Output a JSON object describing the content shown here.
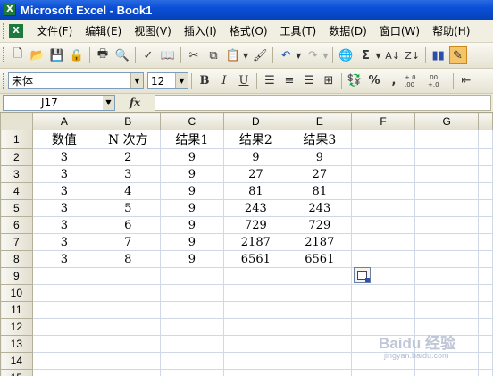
{
  "window": {
    "title": "Microsoft Excel - Book1",
    "app_icon": "X"
  },
  "menu": {
    "items": [
      {
        "label": "文件(F)"
      },
      {
        "label": "编辑(E)"
      },
      {
        "label": "视图(V)"
      },
      {
        "label": "插入(I)"
      },
      {
        "label": "格式(O)"
      },
      {
        "label": "工具(T)"
      },
      {
        "label": "数据(D)"
      },
      {
        "label": "窗口(W)"
      },
      {
        "label": "帮助(H)"
      }
    ]
  },
  "format_toolbar": {
    "font_name": "宋体",
    "font_size": "12",
    "bold": "B",
    "italic": "I",
    "underline": "U",
    "percent": "%",
    "comma": ",",
    "inc_decimal": "+.0 .00",
    "dec_decimal": ".00 +.0"
  },
  "formula_bar": {
    "name_box": "J17",
    "fx": "fx",
    "content": ""
  },
  "columns": [
    "A",
    "B",
    "C",
    "D",
    "E",
    "F",
    "G"
  ],
  "rows": [
    [
      "数值",
      "N 次方",
      "结果1",
      "结果2",
      "结果3",
      "",
      ""
    ],
    [
      "3",
      "2",
      "9",
      "9",
      "9",
      "",
      ""
    ],
    [
      "3",
      "3",
      "9",
      "27",
      "27",
      "",
      ""
    ],
    [
      "3",
      "4",
      "9",
      "81",
      "81",
      "",
      ""
    ],
    [
      "3",
      "5",
      "9",
      "243",
      "243",
      "",
      ""
    ],
    [
      "3",
      "6",
      "9",
      "729",
      "729",
      "",
      ""
    ],
    [
      "3",
      "7",
      "9",
      "2187",
      "2187",
      "",
      ""
    ],
    [
      "3",
      "8",
      "9",
      "6561",
      "6561",
      "",
      ""
    ],
    [
      "",
      "",
      "",
      "",
      "",
      "",
      ""
    ],
    [
      "",
      "",
      "",
      "",
      "",
      "",
      ""
    ],
    [
      "",
      "",
      "",
      "",
      "",
      "",
      ""
    ],
    [
      "",
      "",
      "",
      "",
      "",
      "",
      ""
    ],
    [
      "",
      "",
      "",
      "",
      "",
      "",
      ""
    ],
    [
      "",
      "",
      "",
      "",
      "",
      "",
      ""
    ],
    [
      "",
      "",
      "",
      "",
      "",
      "",
      ""
    ]
  ],
  "watermark": {
    "text": "Baidu 经验",
    "sub": "jingyan.baidu.com"
  }
}
